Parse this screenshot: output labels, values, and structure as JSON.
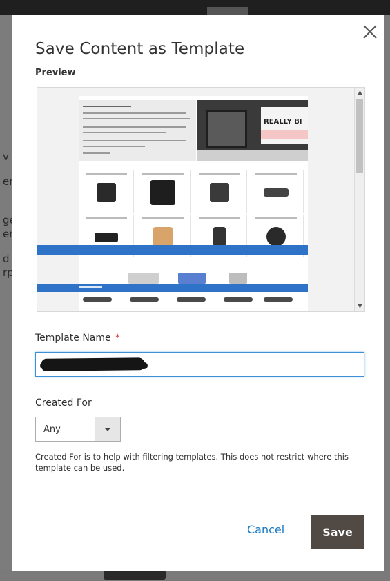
{
  "modal": {
    "title": "Save Content as Template",
    "close_icon": "close-icon"
  },
  "preview": {
    "label": "Preview",
    "hero_banner_text": "REALLY BI"
  },
  "form": {
    "template_name": {
      "label": "Template Name",
      "required_mark": "*",
      "value": ""
    },
    "created_for": {
      "label": "Created For",
      "selected": "Any",
      "help": "Created For is to help with filtering templates. This does not restrict where this template can be used."
    }
  },
  "actions": {
    "cancel_label": "Cancel",
    "save_label": "Save"
  },
  "backdrop_fragments": [
    "v",
    "en",
    "ge",
    "en",
    "d",
    "rp"
  ],
  "colors": {
    "primary_button": "#514943",
    "link": "#1979c3",
    "required": "#e22626",
    "focus_border": "#3d8fd6",
    "preview_bar": "#2e73c8"
  }
}
